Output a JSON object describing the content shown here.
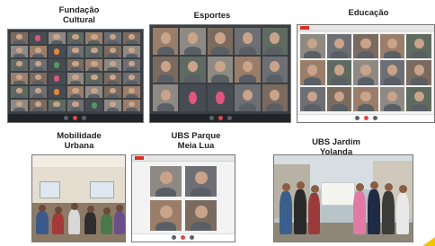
{
  "captions": {
    "fundacao": [
      "Fundação",
      "Cultural"
    ],
    "esportes": [
      "Esportes"
    ],
    "educacao": [
      "Educação"
    ],
    "mobilidade": [
      "Mobilidade",
      "Urbana"
    ],
    "ubs_parque": [
      "UBS Parque",
      "Meia Lua"
    ],
    "ubs_jardim": [
      "UBS Jardim",
      "Yolanda"
    ]
  },
  "colors": {
    "caption_text": "#222222",
    "accent_corner": "#f2c500"
  }
}
